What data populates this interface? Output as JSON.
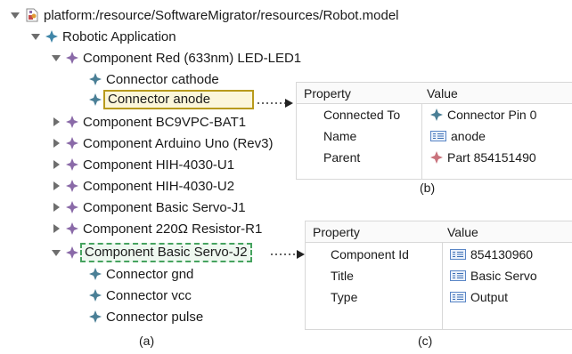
{
  "tree": {
    "root": "platform:/resource/SoftwareMigrator/resources/Robot.model",
    "app": "Robotic Application",
    "led": {
      "label": "Component Red (633nm) LED-LED1",
      "children": [
        "Connector cathode",
        "Connector anode"
      ]
    },
    "collapsed": [
      "Component BC9VPC-BAT1",
      "Component Arduino Uno (Rev3)",
      "Component HIH-4030-U1",
      "Component HIH-4030-U2",
      "Component Basic Servo-J1",
      "Component 220Ω Resistor-R1"
    ],
    "servo": {
      "label": "Component Basic Servo-J2",
      "children": [
        "Connector gnd",
        "Connector vcc",
        "Connector pulse"
      ]
    },
    "caption": "(a)"
  },
  "tableB": {
    "header": {
      "property": "Property",
      "value": "Value"
    },
    "rows": [
      {
        "key": "Connected To",
        "value": "Connector Pin 0",
        "icon": "connector-icon"
      },
      {
        "key": "Name",
        "value": "anode",
        "icon": "text-value-icon"
      },
      {
        "key": "Parent",
        "value": "Part 854151490",
        "icon": "part-icon"
      }
    ],
    "caption": "(b)"
  },
  "tableC": {
    "header": {
      "property": "Property",
      "value": "Value"
    },
    "rows": [
      {
        "key": "Component Id",
        "value": "854130960",
        "icon": "text-value-icon"
      },
      {
        "key": "Title",
        "value": "Basic Servo",
        "icon": "text-value-icon"
      },
      {
        "key": "Type",
        "value": "Output",
        "icon": "text-value-icon"
      }
    ],
    "caption": "(c)"
  },
  "colors": {
    "component": "#8a6aa8",
    "connector": "#4a7f96",
    "app": "#3f86a8",
    "selection_gold": "#b89a1c",
    "selection_green": "#46a35f"
  }
}
